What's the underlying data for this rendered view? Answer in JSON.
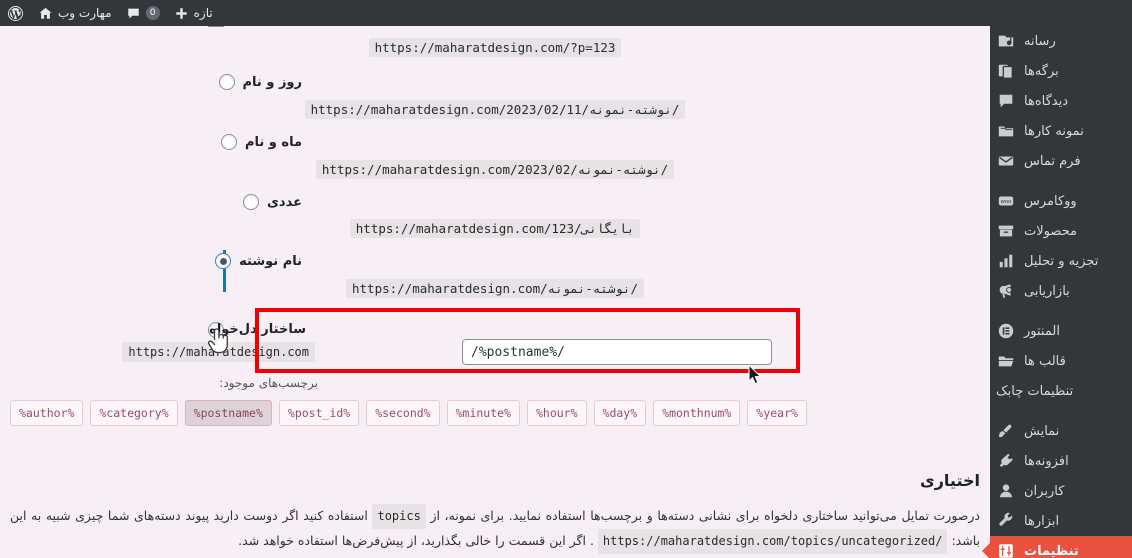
{
  "adminbar": {
    "items": [
      {
        "icon": "wordpress-logo-icon",
        "label": ""
      },
      {
        "icon": "home-icon",
        "label": "مهارت وب"
      },
      {
        "icon": "comment-icon",
        "label": "",
        "count": "0"
      },
      {
        "icon": "plus-icon",
        "label": "تازه"
      }
    ]
  },
  "sidebar": {
    "items": [
      {
        "label": "رسانه",
        "icon": "media-icon",
        "active": false,
        "sub": false
      },
      {
        "label": "برگه‌ها",
        "icon": "pages-icon",
        "active": false,
        "sub": false
      },
      {
        "label": "دیدگاه‌ها",
        "icon": "comments-icon",
        "active": false,
        "sub": false
      },
      {
        "label": "نمونه کارها",
        "icon": "portfolio-folder-icon",
        "active": false,
        "sub": false
      },
      {
        "label": "فرم تماس",
        "icon": "envelope-icon",
        "active": false,
        "sub": false
      },
      {
        "label": "ووکامرس",
        "icon": "woocommerce-icon",
        "active": false,
        "sub": false
      },
      {
        "label": "محصولات",
        "icon": "products-box-icon",
        "active": false,
        "sub": false
      },
      {
        "label": "تجزیه و تحلیل",
        "icon": "analytics-bars-icon",
        "active": false,
        "sub": false
      },
      {
        "label": "بازاریابی",
        "icon": "marketing-megaphone-icon",
        "active": false,
        "sub": false
      },
      {
        "label": "المنتور",
        "icon": "elementor-icon",
        "active": false,
        "sub": false
      },
      {
        "label": "قالب ها",
        "icon": "templates-folder-icon",
        "active": false,
        "sub": false
      },
      {
        "label": "تنظیمات چابک",
        "icon": "none-icon",
        "active": false,
        "sub": true
      },
      {
        "label": "نمایش",
        "icon": "appearance-brush-icon",
        "active": false,
        "sub": false
      },
      {
        "label": "افزونه‌ها",
        "icon": "plugins-plug-icon",
        "active": false,
        "sub": false
      },
      {
        "label": "کاربران",
        "icon": "users-person-icon",
        "active": false,
        "sub": false
      },
      {
        "label": "ابزارها",
        "icon": "tools-wrench-icon",
        "active": false,
        "sub": false
      },
      {
        "label": "تنظیمات",
        "icon": "settings-sliders-icon",
        "active": true,
        "sub": false
      }
    ]
  },
  "permalinks": {
    "options": [
      {
        "label": "",
        "example": "https://maharatdesign.com/?p=123",
        "selected": false,
        "cut_off": true
      },
      {
        "label": "روز و نام",
        "example": "https://maharatdesign.com/2023/02/11/نوشته-نمونه/",
        "selected": false,
        "cut_off": false
      },
      {
        "label": "ماه و نام",
        "example": "https://maharatdesign.com/2023/02/نوشته-نمونه/",
        "selected": false,
        "cut_off": false
      },
      {
        "label": "عددی",
        "example": "https://maharatdesign.com/123/بایگانی",
        "selected": false,
        "cut_off": false
      },
      {
        "label": "نام نوشته",
        "example": "https://maharatdesign.com/نوشته-نمونه/",
        "selected": true,
        "cut_off": false
      }
    ],
    "custom": {
      "label": "ساختار دل‌خواه",
      "prefix": "https://maharatdesign.com",
      "value": "/%postname%/",
      "selected": false
    },
    "available_tags_label": "برچسب‌های موجود:",
    "tags": [
      {
        "name": "%author%",
        "pressed": false
      },
      {
        "name": "%category%",
        "pressed": false
      },
      {
        "name": "%postname%",
        "pressed": true
      },
      {
        "name": "%post_id%",
        "pressed": false
      },
      {
        "name": "%second%",
        "pressed": false
      },
      {
        "name": "%minute%",
        "pressed": false
      },
      {
        "name": "%hour%",
        "pressed": false
      },
      {
        "name": "%day%",
        "pressed": false
      },
      {
        "name": "%monthnum%",
        "pressed": false
      },
      {
        "name": "%year%",
        "pressed": false
      }
    ]
  },
  "optional": {
    "title": "اختیاری",
    "text_part1": "درصورت تمایل می‌توانید ساختاری دلخواه برای نشانی دسته‌ها و برچسب‌ها استفاده نمایید. برای نمونه، از",
    "code1": "topics",
    "text_part2": "استفاده کنید اگر دوست دارید پیوند دسته‌های شما چیزی شبیه به این باشد:",
    "code2": "https://maharatdesign.com/topics/uncategorized/",
    "text_part3": ". اگر این قسمت را خالی بگذارید، از پیش‌فرض‌ها استفاده خواهد شد."
  },
  "colors": {
    "sidebar_bg": "#32373c",
    "sidebar_active": "#e8523f",
    "content_bg": "#f7eff5",
    "highlight_box": "#f00000",
    "focus_blue": "#2271b1",
    "tag_text": "#a34a5e"
  }
}
